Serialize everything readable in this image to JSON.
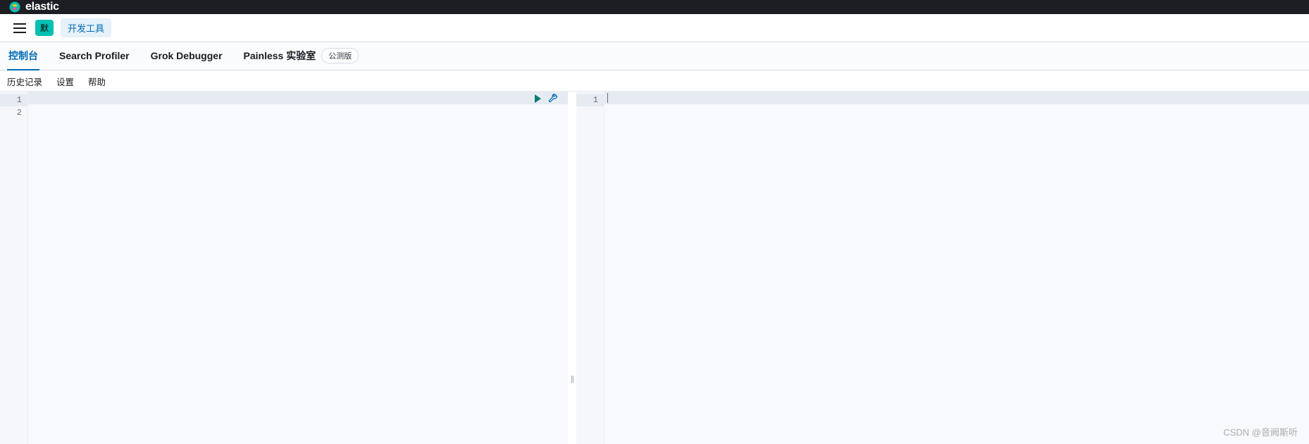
{
  "header": {
    "app_name": "elastic",
    "badge_default": "默",
    "breadcrumb": "开发工具"
  },
  "tabs": [
    {
      "label": "控制台",
      "active": true
    },
    {
      "label": "Search Profiler",
      "active": false
    },
    {
      "label": "Grok Debugger",
      "active": false
    },
    {
      "label": "Painless 实验室",
      "active": false,
      "beta": "公测版"
    }
  ],
  "toolbar": {
    "history": "历史记录",
    "settings": "设置",
    "help": "帮助"
  },
  "editor": {
    "left_gutter": [
      "1",
      "2"
    ],
    "right_gutter": [
      "1"
    ],
    "highlighted_left": 0,
    "highlighted_right": 0
  },
  "watermark": "CSDN @音阙斯听"
}
